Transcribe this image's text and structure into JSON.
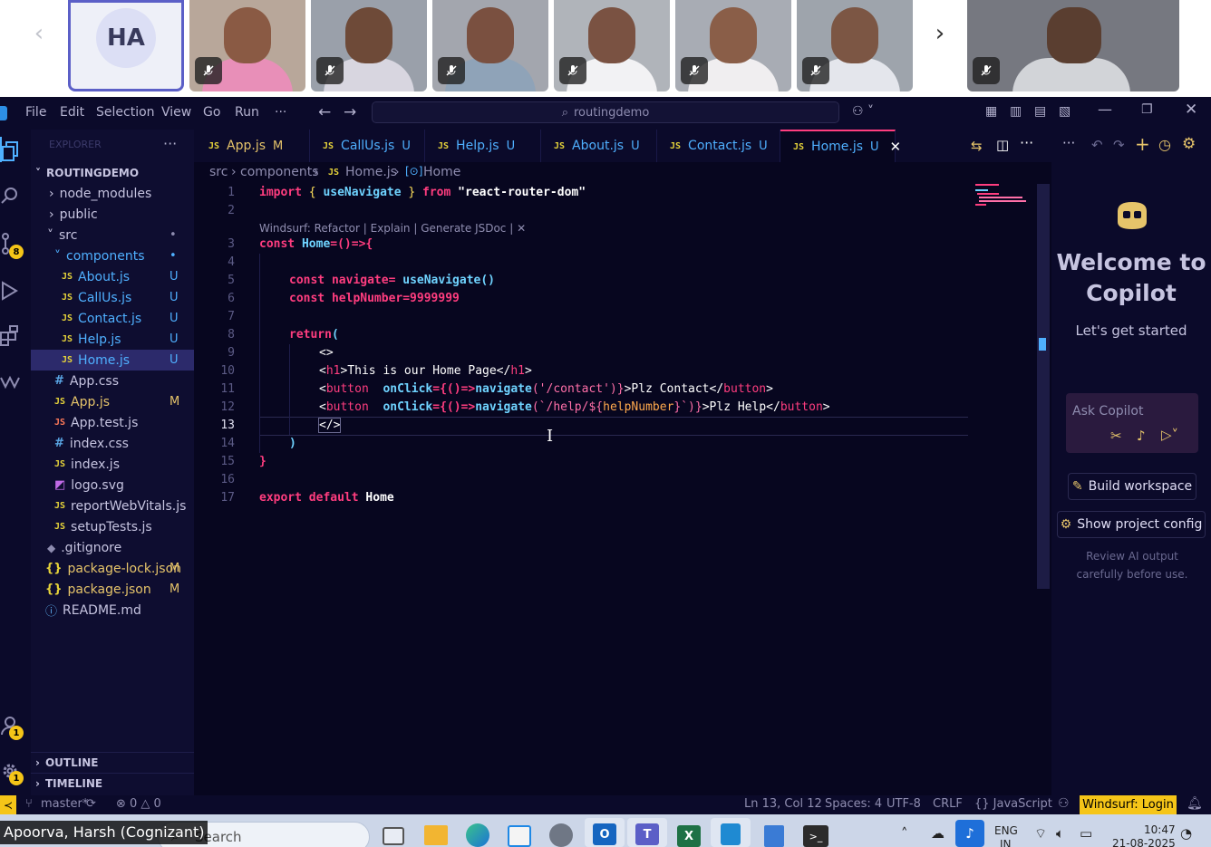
{
  "meeting": {
    "initials": "HA",
    "tiles": [
      "participant-1",
      "participant-2",
      "participant-3",
      "participant-4",
      "participant-5",
      "participant-6",
      "participant-7"
    ],
    "caption": "Apoorva, Harsh (Cognizant)"
  },
  "titlebar": {
    "menu": [
      "File",
      "Edit",
      "Selection",
      "View",
      "Go",
      "Run",
      "···"
    ],
    "search": "routingdemo"
  },
  "explorer": {
    "heading": "EXPLORER",
    "project": "ROUTINGDEMO",
    "items": [
      {
        "label": "node_modules",
        "status": ""
      },
      {
        "label": "public",
        "status": ""
      },
      {
        "label": "src",
        "status": "•"
      },
      {
        "label": "components",
        "status": "•"
      },
      {
        "label": "About.js",
        "status": "U"
      },
      {
        "label": "CallUs.js",
        "status": "U"
      },
      {
        "label": "Contact.js",
        "status": "U"
      },
      {
        "label": "Help.js",
        "status": "U"
      },
      {
        "label": "Home.js",
        "status": "U"
      },
      {
        "label": "App.css",
        "status": ""
      },
      {
        "label": "App.js",
        "status": "M"
      },
      {
        "label": "App.test.js",
        "status": ""
      },
      {
        "label": "index.css",
        "status": ""
      },
      {
        "label": "index.js",
        "status": ""
      },
      {
        "label": "logo.svg",
        "status": ""
      },
      {
        "label": "reportWebVitals.js",
        "status": ""
      },
      {
        "label": "setupTests.js",
        "status": ""
      },
      {
        "label": ".gitignore",
        "status": ""
      },
      {
        "label": "package-lock.json",
        "status": "M"
      },
      {
        "label": "package.json",
        "status": "M"
      },
      {
        "label": "README.md",
        "status": ""
      }
    ],
    "outline": "OUTLINE",
    "timeline": "TIMELINE"
  },
  "tabs": [
    {
      "label": "App.js",
      "status": "M"
    },
    {
      "label": "CallUs.js",
      "status": "U"
    },
    {
      "label": "Help.js",
      "status": "U"
    },
    {
      "label": "About.js",
      "status": "U"
    },
    {
      "label": "Contact.js",
      "status": "U"
    },
    {
      "label": "Home.js",
      "status": "U"
    }
  ],
  "breadcrumb": {
    "src": "src",
    "components": "components",
    "file": "Home.js",
    "symbol": "Home"
  },
  "codelens": "Windsurf: Refactor | Explain | Generate JSDoc | ✕",
  "code": {
    "line_numbers": [
      "1",
      "2",
      "3",
      "4",
      "5",
      "6",
      "7",
      "8",
      "9",
      "10",
      "11",
      "12",
      "13",
      "14",
      "15",
      "16",
      "17"
    ],
    "l1": {
      "import": "import",
      "brace_open": "{",
      "name": "useNavigate",
      "brace_close": "}",
      "from": "from",
      "module": "\"react-router-dom\""
    },
    "l3": {
      "const": "const",
      "name": "Home",
      "rest": "=()=>{"
    },
    "l5": {
      "const": "const",
      "text": "navigate= ",
      "call": "useNavigate()"
    },
    "l6": {
      "const": "const",
      "text": "helpNumber=9999999"
    },
    "l8": {
      "kw": "return",
      "paren": "("
    },
    "l9": "<>",
    "l10": {
      "open": "<",
      "tag": "h1",
      "mid": ">This is our Home Page</",
      "tag2": "h1",
      "close": ">"
    },
    "l11": {
      "open": "<",
      "tag": "button",
      "attr": "  onClick",
      "p1": "={()=>",
      "fn": "navigate",
      "p2": "('/contact')}",
      "text": ">Plz Contact</",
      "tag2": "button",
      "close": ">"
    },
    "l12": {
      "open": "<",
      "tag": "button",
      "attr": "  onClick",
      "p1": "={()=>",
      "fn": "navigate",
      "p2": "(`/help/${",
      "var": "helpNumber",
      "p3": "}`)}",
      "text": ">Plz Help</",
      "tag2": "button",
      "close": ">"
    },
    "l13": "</>",
    "l14": ")",
    "l15": "}",
    "l17": {
      "export": "export",
      "default": "default",
      "name": "Home"
    }
  },
  "copilot": {
    "title": "Welcome to Copilot",
    "subtitle": "Let's get started",
    "ask_placeholder": "Ask Copilot",
    "build": "Build workspace",
    "config": "Show project config",
    "review": "Review AI output carefully before use."
  },
  "status": {
    "branch": "master*",
    "errors": "⊗ 0 △ 0",
    "position": "Ln 13, Col 12",
    "spaces": "Spaces: 4",
    "encoding": "UTF-8",
    "eol": "CRLF",
    "language": "{} JavaScript",
    "windsurf": "Windsurf: Login"
  },
  "taskbar": {
    "search": "Search",
    "lang": "ENG",
    "lang2": "IN",
    "time": "10:47",
    "date": "21-08-2025"
  },
  "badges": {
    "scm": "8",
    "accounts": "1",
    "settings": "1"
  }
}
